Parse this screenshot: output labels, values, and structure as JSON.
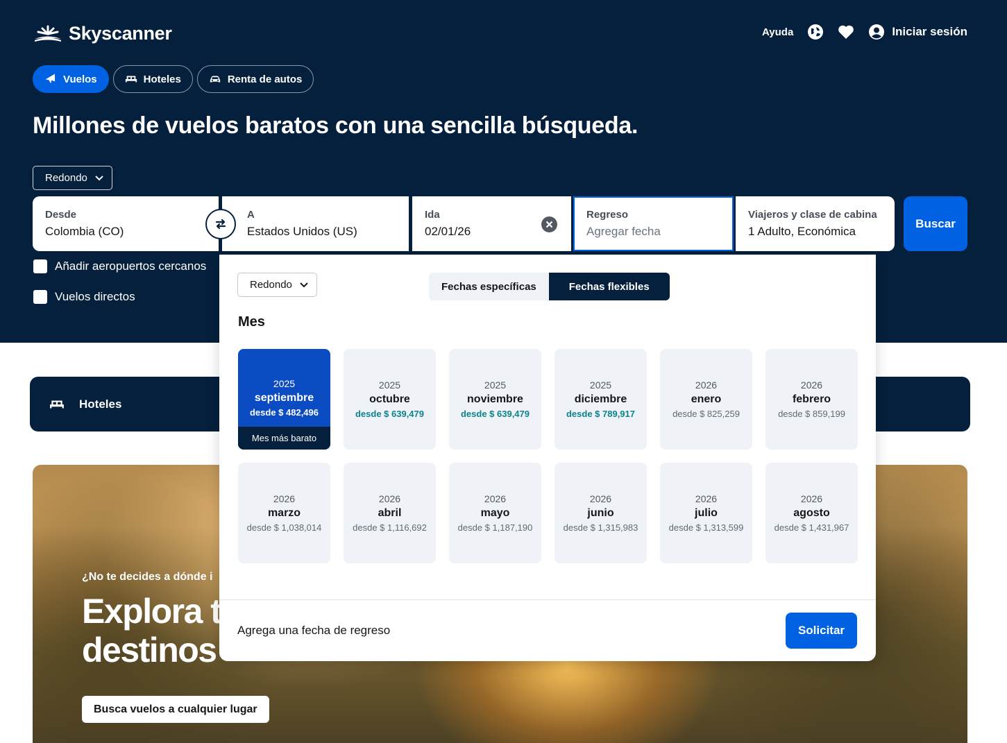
{
  "header": {
    "logo_text": "Skyscanner",
    "help": "Ayuda",
    "login": "Iniciar sesión",
    "icons": [
      "globe-icon",
      "heart-icon",
      "account-icon"
    ]
  },
  "tabs": [
    {
      "label": "Vuelos",
      "icon": "plane-icon",
      "active": true
    },
    {
      "label": "Hoteles",
      "icon": "bed-icon",
      "active": false
    },
    {
      "label": "Renta de autos",
      "icon": "car-icon",
      "active": false
    }
  ],
  "headline": "Millones de vuelos baratos con una sencilla búsqueda.",
  "search": {
    "trip_type": "Redondo",
    "from": {
      "label": "Desde",
      "value": "Colombia (CO)"
    },
    "to": {
      "label": "A",
      "value": "Estados Unidos (US)"
    },
    "depart": {
      "label": "Ida",
      "value": "02/01/26"
    },
    "return": {
      "label": "Regreso",
      "placeholder": "Agregar fecha"
    },
    "travellers": {
      "label": "Viajeros y clase de cabina",
      "value": "1 Adulto, Económica"
    },
    "search_button": "Buscar",
    "nearby_airports": "Añadir aeropuertos cercanos",
    "direct_flights": "Vuelos directos"
  },
  "hotels_strip": {
    "label": "Hoteles"
  },
  "banner": {
    "small": "¿No te decides a dónde i",
    "big_line1": "Explora t",
    "big_line2": "destinos",
    "cta": "Busca vuelos a cualquier lugar"
  },
  "date_popover": {
    "trip_type": "Redondo",
    "mode_specific": "Fechas específicas",
    "mode_flexible": "Fechas flexibles",
    "active_mode": "flexible",
    "section_title": "Mes",
    "months": [
      {
        "year": "2025",
        "month": "septiembre",
        "price": "desde $ 482,496",
        "highlight": "selected",
        "tag": "Mes más barato"
      },
      {
        "year": "2025",
        "month": "octubre",
        "price": "desde $ 639,479",
        "highlight": "green"
      },
      {
        "year": "2025",
        "month": "noviembre",
        "price": "desde $ 639,479",
        "highlight": "green"
      },
      {
        "year": "2025",
        "month": "diciembre",
        "price": "desde $ 789,917",
        "highlight": "green"
      },
      {
        "year": "2026",
        "month": "enero",
        "price": "desde $ 825,259",
        "highlight": "none"
      },
      {
        "year": "2026",
        "month": "febrero",
        "price": "desde $ 859,199",
        "highlight": "none"
      },
      {
        "year": "2026",
        "month": "marzo",
        "price": "desde $ 1,038,014",
        "highlight": "none"
      },
      {
        "year": "2026",
        "month": "abril",
        "price": "desde $ 1,116,692",
        "highlight": "none"
      },
      {
        "year": "2026",
        "month": "mayo",
        "price": "desde $ 1,187,190",
        "highlight": "none"
      },
      {
        "year": "2026",
        "month": "junio",
        "price": "desde $ 1,315,983",
        "highlight": "none"
      },
      {
        "year": "2026",
        "month": "julio",
        "price": "desde $ 1,313,599",
        "highlight": "none"
      },
      {
        "year": "2026",
        "month": "agosto",
        "price": "desde $ 1,431,967",
        "highlight": "none"
      }
    ],
    "footer_message": "Agrega una fecha de regreso",
    "apply_button": "Solicitar"
  },
  "colors": {
    "navy": "#05203c",
    "primary_blue": "#0062e3",
    "selected_month": "#0b4cc3",
    "cheap_green": "#0c838a",
    "card_bg": "#eff3f8"
  }
}
